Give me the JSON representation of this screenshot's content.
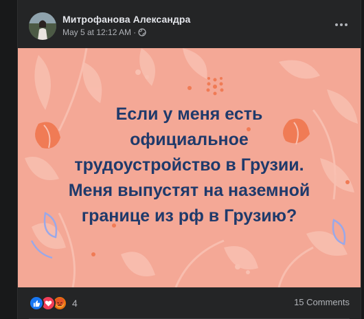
{
  "post": {
    "author": "Митрофанова Александра",
    "date": "May 5 at 12:12 AM",
    "separator": "·",
    "privacy_icon": "globe-icon",
    "more_icon": "more-options-icon"
  },
  "image": {
    "text": "Если у меня есть\nофициальное\nтрудоустройство в Грузии.\nМеня выпустят на наземной\nгранице из рф в Грузию?",
    "background_color": "#f4a896",
    "text_color": "#1f3a6b"
  },
  "footer": {
    "reaction_icons": [
      "like-icon",
      "love-icon",
      "angry-icon"
    ],
    "reaction_count": "4",
    "comments": "15 Comments"
  }
}
